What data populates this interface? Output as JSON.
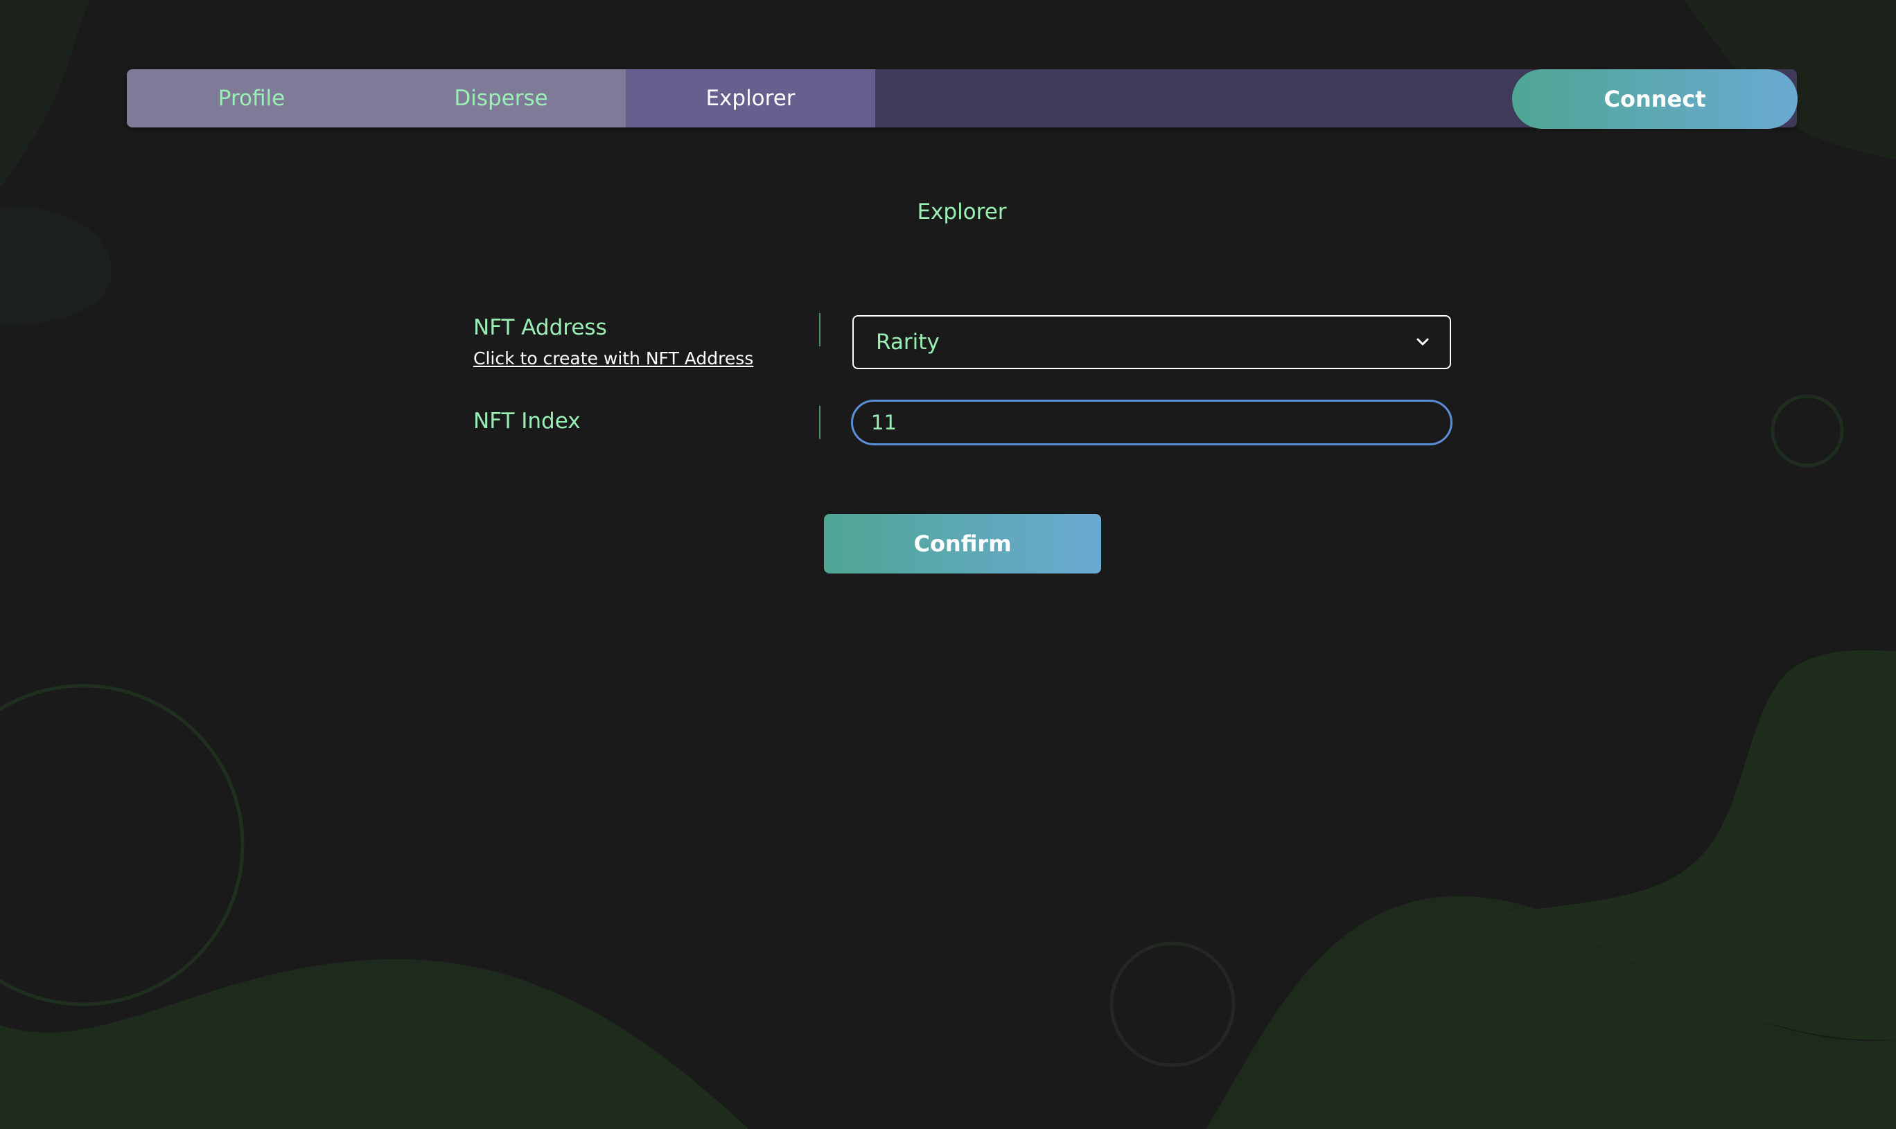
{
  "nav": {
    "tabs": [
      {
        "label": "Profile",
        "active": false
      },
      {
        "label": "Disperse",
        "active": false
      },
      {
        "label": "Explorer",
        "active": true
      }
    ],
    "connect_label": "Connect"
  },
  "main": {
    "title": "Explorer",
    "nft_address": {
      "label": "NFT Address",
      "link_text": "Click to create with NFT Address",
      "selected": "Rarity"
    },
    "nft_index": {
      "label": "NFT Index",
      "value": "11"
    },
    "confirm_label": "Confirm"
  },
  "colors": {
    "background": "#1a1a1a",
    "accent_text": "#9af0b4",
    "button_gradient_start": "#4fa693",
    "button_gradient_end": "#6aaad3",
    "input_focus_border": "#5b8fd9"
  },
  "icons": {
    "select_chevron": "chevron-down-icon"
  }
}
